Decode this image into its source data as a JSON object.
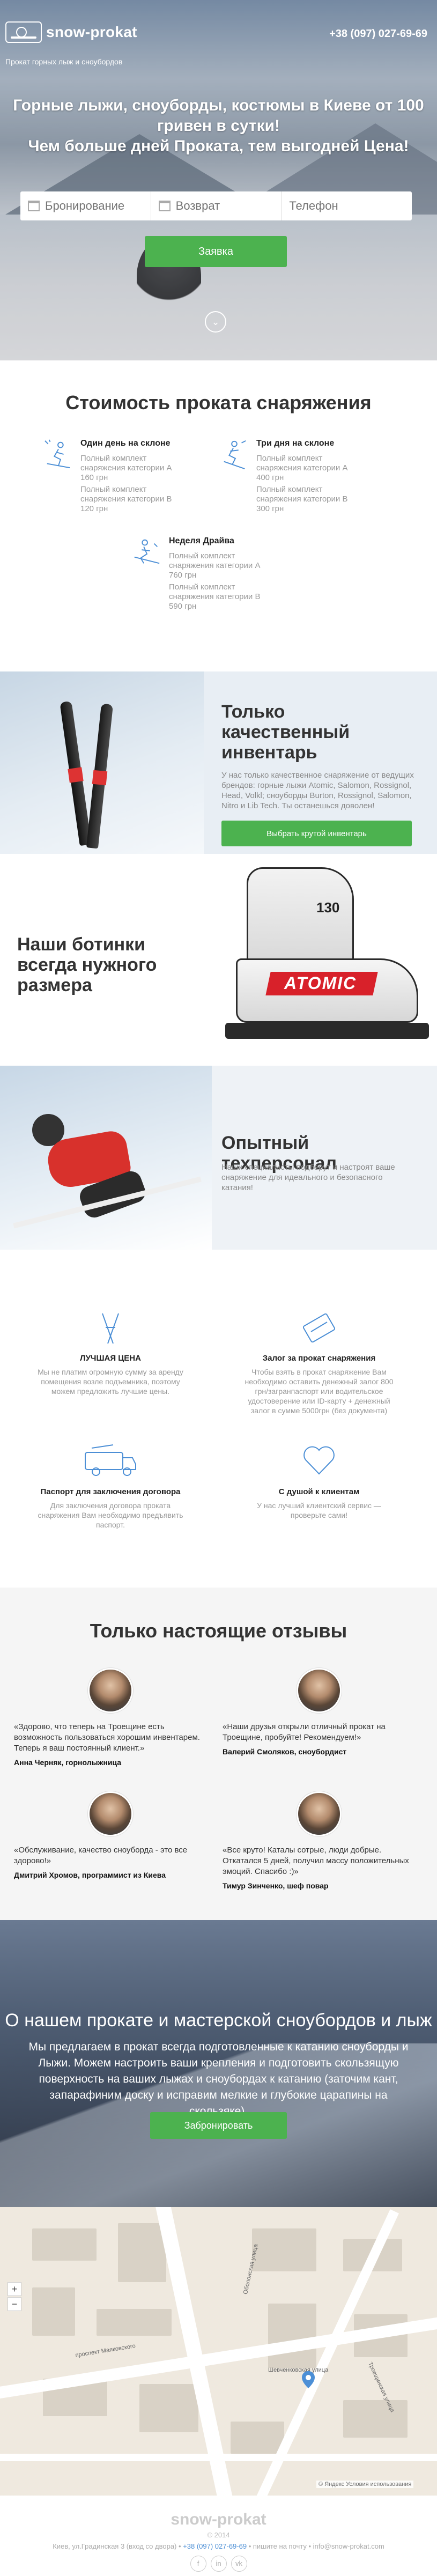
{
  "header": {
    "logo_text": "snow-prokat",
    "tagline": "Прокат горных лыж и сноубордов",
    "phone": "+38 (097) 027-69-69"
  },
  "hero": {
    "title_line1": "Горные лыжи, сноуборды, костюмы в Киеве от 100 гривен в сутки!",
    "title_line2": "Чем больше дней Проката, тем выгодней Цена!",
    "form": {
      "booking_placeholder": "Бронирование",
      "return_placeholder": "Возврат",
      "phone_placeholder": "Телефон"
    },
    "order_button": "Заявка"
  },
  "prices": {
    "title": "Стоимость проката снаряжения",
    "items": [
      {
        "name": "Один день на склоне",
        "line1": "Полный комплект снаряжения категории А 160 грн",
        "line2": "Полный комплект снаряжения категории В 120 грн"
      },
      {
        "name": "Три дня на склоне",
        "line1": "Полный комплект снаряжения категории А 400 грн",
        "line2": "Полный комплект снаряжения категории В 300 грн"
      },
      {
        "name": "Неделя Драйва",
        "line1": "Полный комплект снаряжения категории А 760 грн",
        "line2": "Полный комплект снаряжения категории В 590 грн"
      }
    ]
  },
  "quality": {
    "title": "Только качественный инвентарь",
    "text": "У нас только качественное снаряжение от ведущих брендов: горные лыжи Atomic, Salomon, Rossignol, Head, Volkl; сноуборды Burton, Rossignol, Salomon, Nitro и Lib Tech. Ты останешься доволен!",
    "button": "Выбрать крутой инвентарь"
  },
  "boots": {
    "title": "Наши ботинки всегда нужного размера",
    "brand": "ATOMIC",
    "model": "130"
  },
  "tech": {
    "title": "Опытный техперсонал",
    "text": "Наши специалисты подберут и настроят ваше снаряжение для идеального и безопасного катания!"
  },
  "benefits": [
    {
      "title": "ЛУЧШАЯ ЦЕНА",
      "text": "Мы не платим огромную сумму за аренду помещения возле подъемника, поэтому можем предложить лучшие цены."
    },
    {
      "title": "Залог за прокат снаряжения",
      "text": "Чтобы взять в прокат снаряжение Вам необходимо оставить денежный залог 800 грн/загранпаспорт или водительское удостоверение или ID-карту + денежный залог в сумме 5000грн (без документа)"
    },
    {
      "title": "Паспорт для заключения договора",
      "text": "Для заключения договора проката снаряжения Вам необходимо предъявить паспорт."
    },
    {
      "title": "С душой к клиентам",
      "text": "У нас лучший клиентский сервис — проверьте сами!"
    }
  ],
  "reviews": {
    "title": "Только настоящие отзывы",
    "items": [
      {
        "text": "«Здорово, что теперь на Троещине есть возможность пользоваться хорошим инвентарем. Теперь я ваш постоянный клиент.»",
        "author": "Анна Черняк, горнолыжница"
      },
      {
        "text": "«Наши друзья открыли отличный прокат на Троещине, пробуйте! Рекомендуем!»",
        "author": "Валерий Смоляков, сноубордист"
      },
      {
        "text": "«Обслуживание, качество сноуборда - это все здорово!»",
        "author": "Дмитрий Хромов, программист из Киева"
      },
      {
        "text": "«Все круто! Каталы сотрые, люди добрые. Откатался 5 дней, получил массу положительных эмоций. Спасибо :)»",
        "author": "Тимур Зинченко, шеф повар"
      }
    ]
  },
  "about": {
    "title": "О нашем прокате и мастерской сноубордов и лыж",
    "text": "Мы предлагаем в прокат всегда подготовленные к катанию сноуборды и Лыжи. Можем настроить ваши крепления и подготовить скользящую поверхность на ваших лыжах и сноубордах к катанию (заточим кант, запарафиним доску и исправим мелкие и глубокие царапины на скользяке).",
    "button": "Забронировать"
  },
  "map": {
    "zoom_in": "+",
    "zoom_out": "−",
    "street_labels": [
      "Оболонская улица",
      "проспект Маяковского",
      "Шевченковская улица",
      "Троещинская улица"
    ],
    "attribution": "© Яндекс  Условия использования"
  },
  "footer": {
    "logo": "snow-prokat",
    "copyright": "© 2014",
    "address": "Киев, ул.Градинская 3 (вход со двора)",
    "phone": "+38 (097) 027-69-69",
    "extra": "• пишите на почту • info@snow-prokat.com",
    "socials": [
      "f",
      "in",
      "vk"
    ]
  },
  "colors": {
    "accent_green": "#4cb24f",
    "icon_blue": "#4c8fd6"
  }
}
